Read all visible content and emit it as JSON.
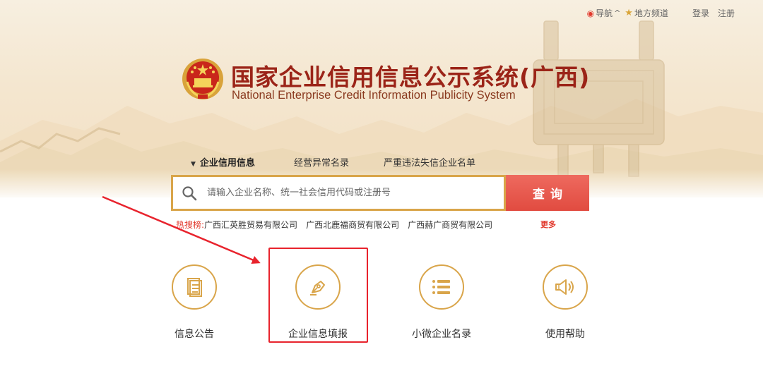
{
  "topnav": {
    "nav_label": "导航",
    "nav_caret": "^",
    "local_label": "地方频道",
    "login": "登录",
    "register": "注册"
  },
  "header": {
    "title_cn": "国家企业信用信息公示系统(广西)",
    "title_en": "National Enterprise Credit Information Publicity System"
  },
  "search": {
    "tabs": [
      {
        "label": "企业信用信息",
        "active": true
      },
      {
        "label": "经营异常名录",
        "active": false
      },
      {
        "label": "严重违法失信企业名单",
        "active": false
      }
    ],
    "placeholder": "请输入企业名称、统一社会信用代码或注册号",
    "button_label": "查询"
  },
  "hot_search": {
    "label": "热搜榜:",
    "items": [
      "广西汇英胜贸易有限公司",
      "广西北鹿福商贸有限公司",
      "广西赫广商贸有限公司"
    ],
    "more": "更多"
  },
  "services": [
    {
      "label": "信息公告",
      "icon": "document-icon"
    },
    {
      "label": "企业信息填报",
      "icon": "pen-icon"
    },
    {
      "label": "小微企业名录",
      "icon": "list-icon"
    },
    {
      "label": "使用帮助",
      "icon": "speaker-icon"
    }
  ],
  "colors": {
    "brand_red": "#9b2418",
    "accent_gold": "#d9a54a",
    "button_red": "#e14b40",
    "highlight_red": "#e8232d"
  }
}
